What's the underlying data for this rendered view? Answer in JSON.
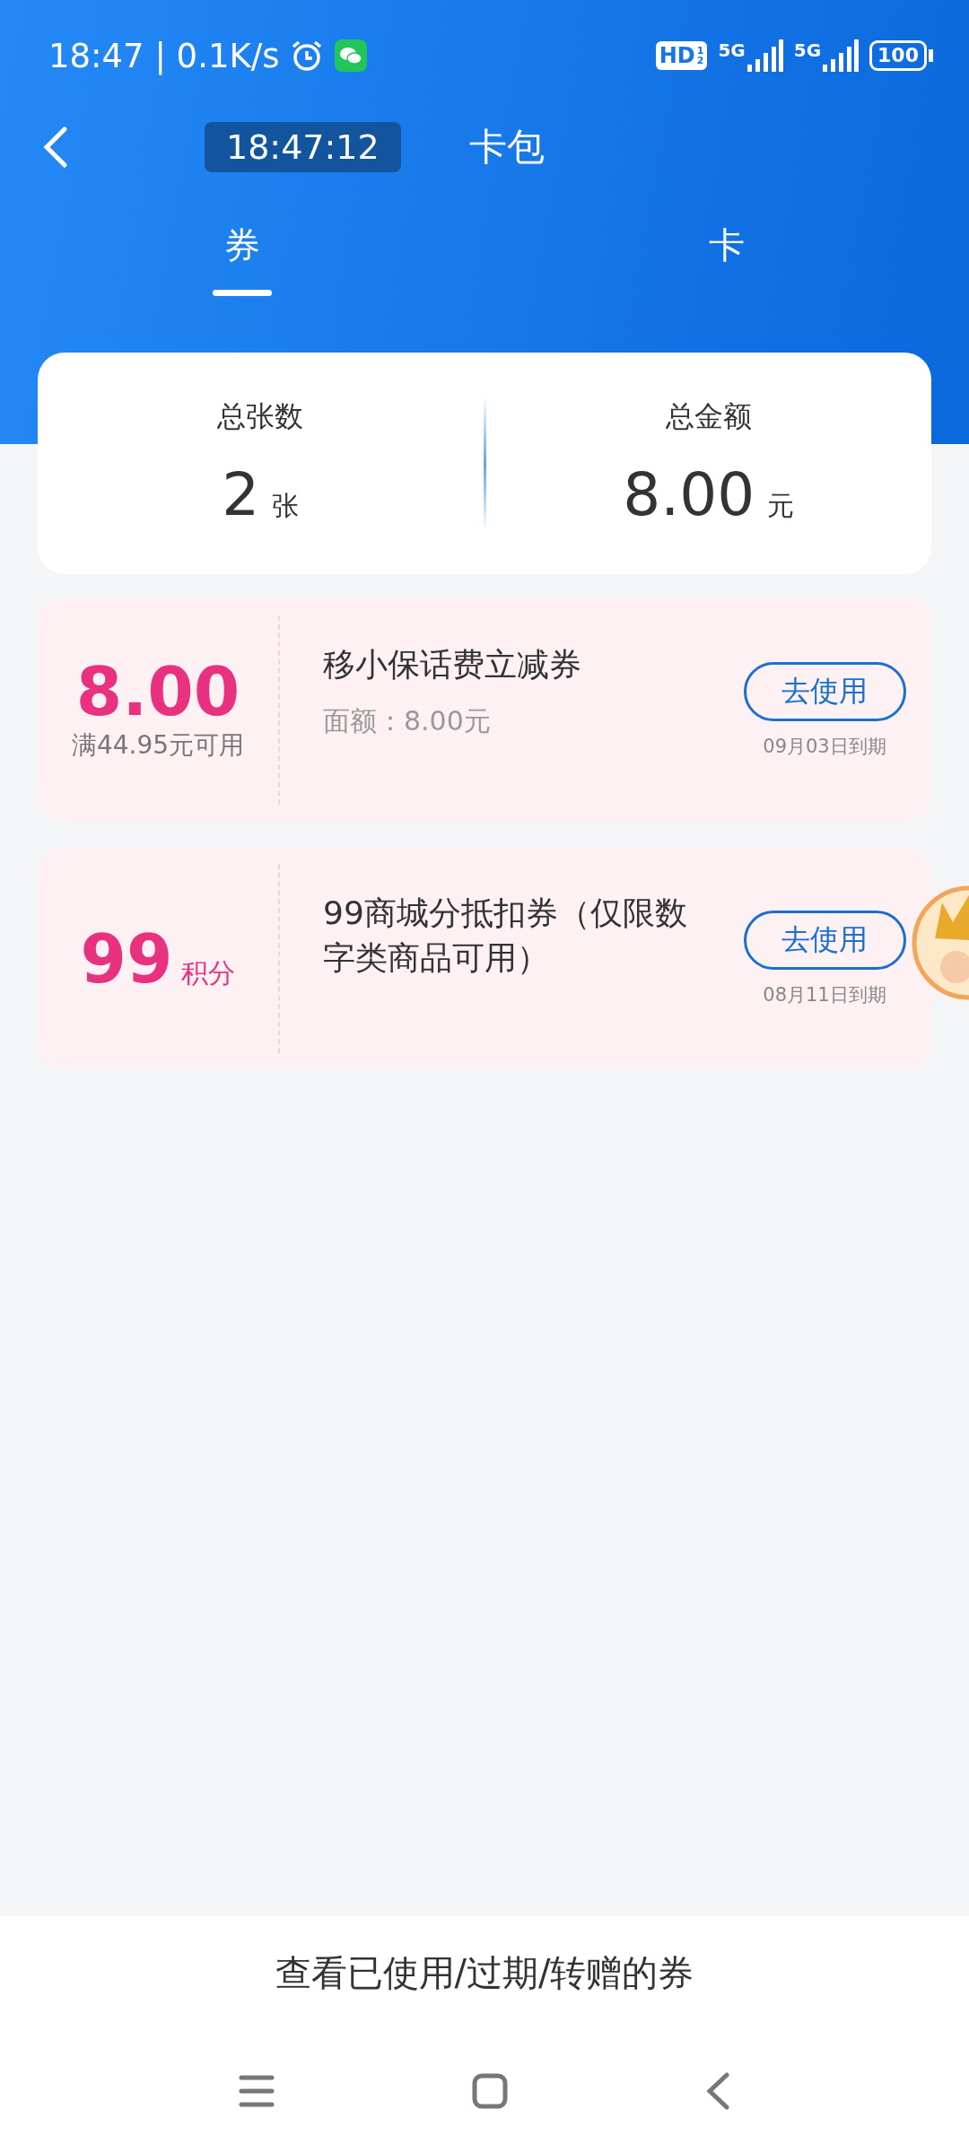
{
  "status_bar": {
    "time": "18:47 | 0.1K/s",
    "hd": "HD",
    "hd_fraction": [
      "1",
      "2"
    ],
    "networks": [
      "5G",
      "5G"
    ],
    "battery": "100"
  },
  "header": {
    "clock": "18:47:12",
    "title": "卡包"
  },
  "tabs": [
    {
      "label": "券",
      "selected": true
    },
    {
      "label": "卡",
      "selected": false
    }
  ],
  "summary": [
    {
      "label": "总张数",
      "value": "2",
      "unit": "张"
    },
    {
      "label": "总金额",
      "value": "8.00",
      "unit": "元"
    }
  ],
  "coupons": [
    {
      "amount": "8.00",
      "condition": "满44.95元可用",
      "title": "移小保话费立减券",
      "face_value": "面额：8.00元",
      "button": "去使用",
      "expiry": "09月03日到期"
    },
    {
      "amount": "99",
      "unit": "积分",
      "title": "99商城分抵扣券（仅限数字类商品可用）",
      "button": "去使用",
      "expiry": "08月11日到期"
    }
  ],
  "footer_link": "查看已使用/过期/转赠的券"
}
